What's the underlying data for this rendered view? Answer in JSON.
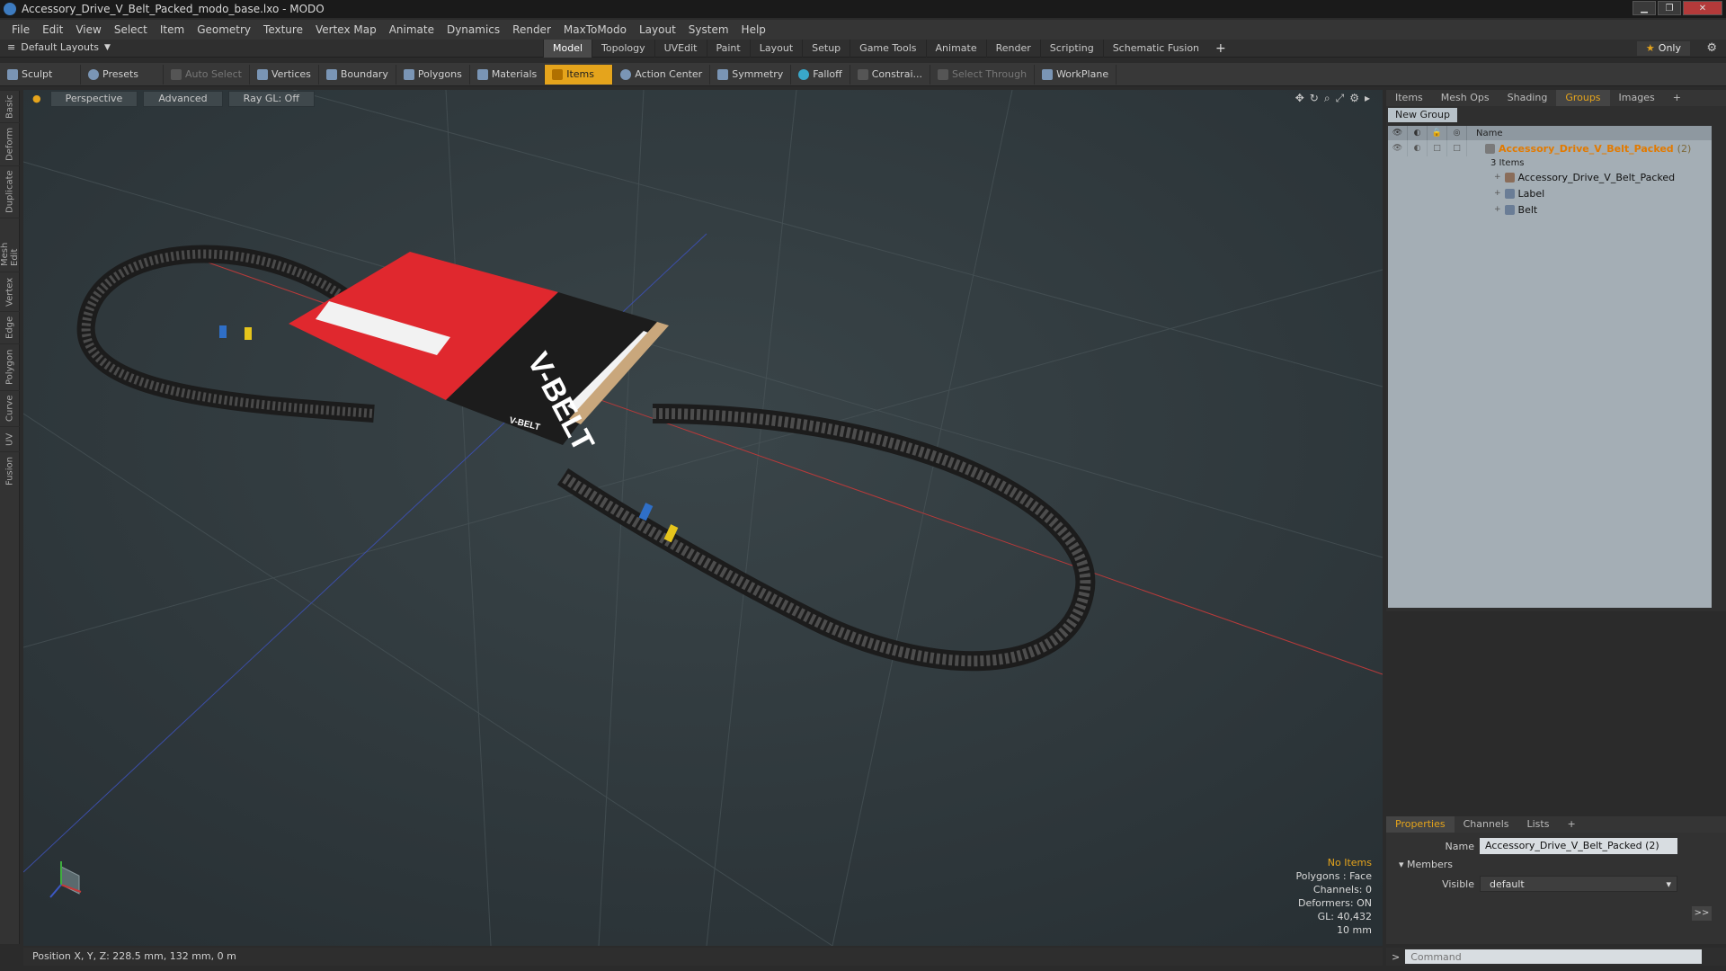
{
  "window": {
    "title": "Accessory_Drive_V_Belt_Packed_modo_base.lxo - MODO"
  },
  "menu": [
    "File",
    "Edit",
    "View",
    "Select",
    "Item",
    "Geometry",
    "Texture",
    "Vertex Map",
    "Animate",
    "Dynamics",
    "Render",
    "MaxToModo",
    "Layout",
    "System",
    "Help"
  ],
  "layouts": {
    "current": "Default Layouts",
    "tabs": [
      "Model",
      "Topology",
      "UVEdit",
      "Paint",
      "Layout",
      "Setup",
      "Game Tools",
      "Animate",
      "Render",
      "Scripting",
      "Schematic Fusion"
    ],
    "active_tab": "Model",
    "only_label": "Only"
  },
  "toolbar": {
    "sculpt": "Sculpt",
    "presets": "Presets",
    "auto_select": "Auto Select",
    "vertices": "Vertices",
    "boundary": "Boundary",
    "polygons": "Polygons",
    "materials": "Materials",
    "items": "Items",
    "action_center": "Action Center",
    "symmetry": "Symmetry",
    "falloff": "Falloff",
    "constrain": "Constrai...",
    "select_through": "Select Through",
    "workplane": "WorkPlane"
  },
  "left_tabs": [
    "Basic",
    "Deform",
    "Duplicate",
    "Mesh Edit",
    "Vertex",
    "Edge",
    "Polygon",
    "Curve",
    "UV",
    "Fusion"
  ],
  "viewport": {
    "view_mode": "Perspective",
    "shading": "Advanced",
    "raygl": "Ray GL: Off",
    "package_text_big": "V-BELT",
    "package_text_small": "V-BELT",
    "info": {
      "selection": "No Items",
      "polygons": "Polygons : Face",
      "channels": "Channels: 0",
      "deformers": "Deformers: ON",
      "gl": "GL: 40,432",
      "grid": "10 mm"
    }
  },
  "status": {
    "position": "Position X, Y, Z:  228.5 mm, 132 mm, 0 m"
  },
  "right_panel": {
    "tabs": [
      "Items",
      "Mesh Ops",
      "Shading",
      "Groups",
      "Images"
    ],
    "active_tab": "Groups",
    "new_group": "New Group",
    "column_name": "Name",
    "group": {
      "name": "Accessory_Drive_V_Belt_Packed",
      "count": "(2)",
      "sub": "3 Items"
    },
    "children": [
      "Accessory_Drive_V_Belt_Packed",
      "Label",
      "Belt"
    ]
  },
  "properties": {
    "tabs": [
      "Properties",
      "Channels",
      "Lists"
    ],
    "active_tab": "Properties",
    "name_label": "Name",
    "name_value": "Accessory_Drive_V_Belt_Packed (2)",
    "members_label": "Members",
    "visible_label": "Visible",
    "visible_value": "default",
    "more": ">>"
  },
  "command": {
    "placeholder": "Command",
    "prompt": ">"
  },
  "colors": {
    "accent": "#e5a41c",
    "package_red": "#e0282e",
    "package_black": "#1c1c1c",
    "viewport_bg": "#323c40"
  }
}
